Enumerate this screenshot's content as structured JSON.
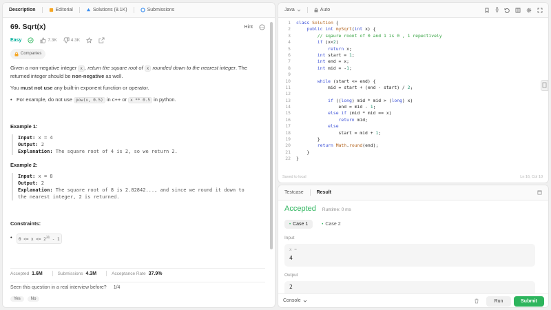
{
  "left_tabs": [
    {
      "label": "Description",
      "icon": "description-icon"
    },
    {
      "label": "Editorial",
      "icon": "editorial-icon"
    },
    {
      "label": "Solutions (8.1K)",
      "icon": "solutions-icon"
    },
    {
      "label": "Submissions",
      "icon": "submissions-icon"
    }
  ],
  "problem": {
    "title": "69. Sqrt(x)",
    "hint_label": "Hint",
    "difficulty": "Easy",
    "likes": "7.3K",
    "dislikes": "4.3K",
    "companies_label": "Companies",
    "p1_a": "Given a non-negative integer ",
    "p1_code": "x",
    "p1_b": ", return the square root of ",
    "p1_code2": "x",
    "p1_c": " rounded down to the nearest integer",
    "p1_d": ". The returned integer should be ",
    "p1_bold": "non-negative",
    "p1_e": " as well.",
    "p2_a": "You ",
    "p2_bold": "must not use",
    "p2_b": " any built-in exponent function or operator.",
    "bullet_a": "For example, do not use ",
    "bullet_code1": "pow(x, 0.5)",
    "bullet_b": " in c++ or ",
    "bullet_code2": "x ** 0.5",
    "bullet_c": " in python.",
    "ex1_title": "Example 1:",
    "ex1_input_label": "Input:",
    "ex1_input": " x = 4",
    "ex1_output_label": "Output:",
    "ex1_output": " 2",
    "ex1_expl_label": "Explanation:",
    "ex1_expl": " The square root of 4 is 2, so we return 2.",
    "ex2_title": "Example 2:",
    "ex2_input_label": "Input:",
    "ex2_input": " x = 8",
    "ex2_output_label": "Output:",
    "ex2_output": " 2",
    "ex2_expl_label": "Explanation:",
    "ex2_expl_1": " The square root of 8 is 2.82842..., and since we round it down to",
    "ex2_expl_2": "the nearest integer, 2 is returned.",
    "constraints_title": "Constraints:",
    "constraint_a": "0 <= x <= 2",
    "constraint_sup": "31",
    "constraint_b": " - 1",
    "accepted_label": "Accepted",
    "accepted_value": "1.6M",
    "submissions_label": "Submissions",
    "submissions_value": "4.3M",
    "rate_label": "Acceptance Rate",
    "rate_value": "37.9%",
    "interview_q": "Seen this question in a real interview before?",
    "interview_count": "1/4",
    "yes_label": "Yes",
    "no_label": "No"
  },
  "editor": {
    "language": "Java",
    "mode": "Auto",
    "saved_text": "Saved to local",
    "cursor_pos": "Ln 16, Col 10"
  },
  "code_lines": [
    [
      "1",
      [
        [
          "kw",
          "class "
        ],
        [
          "fn",
          "Solution "
        ],
        [
          "",
          "{"
        ]
      ]
    ],
    [
      "2",
      [
        [
          "",
          "    "
        ],
        [
          "kw",
          "public int "
        ],
        [
          "fn",
          "mySqrt"
        ],
        [
          "",
          "("
        ],
        [
          "kw",
          "int "
        ],
        [
          "",
          "x) {"
        ]
      ]
    ],
    [
      "3",
      [
        [
          "",
          "        "
        ],
        [
          "cm",
          "// sqaure roont of 0 and 1 is 0 , 1 repectively"
        ]
      ]
    ],
    [
      "4",
      [
        [
          "",
          "        "
        ],
        [
          "kw",
          "if "
        ],
        [
          "",
          "(x<"
        ],
        [
          "nm",
          "2"
        ],
        [
          "",
          ")"
        ]
      ]
    ],
    [
      "5",
      [
        [
          "",
          "            "
        ],
        [
          "kw",
          "return "
        ],
        [
          "",
          "x;"
        ]
      ]
    ],
    [
      "6",
      [
        [
          "",
          "        "
        ],
        [
          "kw",
          "int "
        ],
        [
          "",
          "start = "
        ],
        [
          "nm",
          "1"
        ],
        [
          "",
          ";"
        ]
      ]
    ],
    [
      "7",
      [
        [
          "",
          "        "
        ],
        [
          "kw",
          "int "
        ],
        [
          "",
          "end = x;"
        ]
      ]
    ],
    [
      "8",
      [
        [
          "",
          "        "
        ],
        [
          "kw",
          "int "
        ],
        [
          "",
          "mid = -"
        ],
        [
          "nm",
          "1"
        ],
        [
          "",
          ";"
        ]
      ]
    ],
    [
      "9",
      [
        [
          "",
          ""
        ]
      ]
    ],
    [
      "10",
      [
        [
          "",
          "        "
        ],
        [
          "kw",
          "while "
        ],
        [
          "",
          "(start <= end) {"
        ]
      ]
    ],
    [
      "11",
      [
        [
          "",
          "            mid = start + (end - start) / "
        ],
        [
          "nm",
          "2"
        ],
        [
          "",
          ";"
        ]
      ]
    ],
    [
      "12",
      [
        [
          "",
          ""
        ]
      ]
    ],
    [
      "13",
      [
        [
          "",
          "            "
        ],
        [
          "kw",
          "if "
        ],
        [
          "",
          "(("
        ],
        [
          "kw",
          "long"
        ],
        [
          "",
          ") mid * mid > ("
        ],
        [
          "kw",
          "long"
        ],
        [
          "",
          ") x)"
        ]
      ]
    ],
    [
      "14",
      [
        [
          "",
          "                end = mid - "
        ],
        [
          "nm",
          "1"
        ],
        [
          "",
          ";"
        ]
      ]
    ],
    [
      "15",
      [
        [
          "",
          "            "
        ],
        [
          "kw",
          "else if "
        ],
        [
          "",
          "(mid * mid == x)"
        ]
      ]
    ],
    [
      "16",
      [
        [
          "",
          "                "
        ],
        [
          "kw",
          "return "
        ],
        [
          "",
          "mid;"
        ]
      ]
    ],
    [
      "17",
      [
        [
          "",
          "            "
        ],
        [
          "kw",
          "else"
        ]
      ]
    ],
    [
      "18",
      [
        [
          "",
          "                start = mid + "
        ],
        [
          "nm",
          "1"
        ],
        [
          "",
          ";"
        ]
      ]
    ],
    [
      "19",
      [
        [
          "",
          "        }"
        ]
      ]
    ],
    [
      "20",
      [
        [
          "",
          "        "
        ],
        [
          "kw",
          "return "
        ],
        [
          "fn",
          "Math"
        ],
        [
          "",
          "."
        ],
        [
          "fn",
          "round"
        ],
        [
          "",
          "(end);"
        ]
      ]
    ],
    [
      "21",
      [
        [
          "",
          "    }"
        ]
      ]
    ],
    [
      "22",
      [
        [
          "",
          "}"
        ]
      ]
    ]
  ],
  "bottom": {
    "tab_testcase": "Testcase",
    "tab_result": "Result",
    "status": "Accepted",
    "runtime": "Runtime: 0 ms",
    "case1": "Case 1",
    "case2": "Case 2",
    "input_label": "Input",
    "input_var": "x =",
    "input_value": "4",
    "output_label": "Output",
    "output_value": "2",
    "console_label": "Console",
    "run_label": "Run",
    "submit_label": "Submit"
  },
  "colors": {
    "easy": "#00af9b",
    "accepted": "#2db55d",
    "submit_bg": "#2db55d"
  }
}
